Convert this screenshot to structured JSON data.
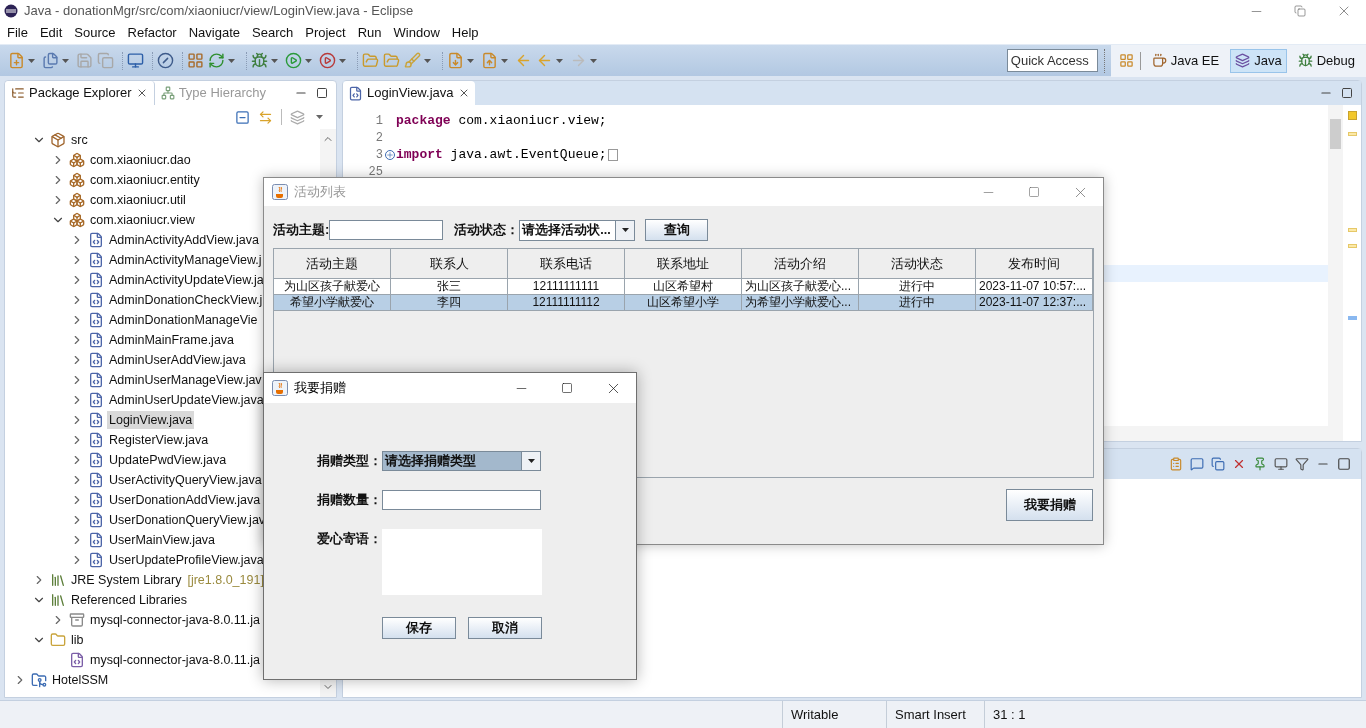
{
  "window": {
    "title": "Java - donationMgr/src/com/xiaoniucr/view/LoginView.java - Eclipse"
  },
  "menu": [
    "File",
    "Edit",
    "Source",
    "Refactor",
    "Navigate",
    "Search",
    "Project",
    "Run",
    "Window",
    "Help"
  ],
  "quick_access": {
    "placeholder": "Quick Access"
  },
  "perspectives": [
    {
      "label": "Java EE",
      "selected": false
    },
    {
      "label": "Java",
      "selected": true
    },
    {
      "label": "Debug",
      "selected": false
    }
  ],
  "left_view": {
    "tabs": [
      {
        "label": "Package Explorer",
        "selected": true
      },
      {
        "label": "Type Hierarchy",
        "selected": false
      }
    ],
    "tree": [
      {
        "children": [
          {
            "label": "src",
            "kind": "source-folder",
            "expanded": true,
            "selected": false,
            "children": [
              {
                "label": "com.xiaoniucr.dao",
                "kind": "package",
                "expanded": false,
                "selected": false
              },
              {
                "label": "com.xiaoniucr.entity",
                "kind": "package",
                "expanded": false,
                "selected": false
              },
              {
                "label": "com.xiaoniucr.util",
                "kind": "package",
                "expanded": false,
                "selected": false
              },
              {
                "label": "com.xiaoniucr.view",
                "kind": "package",
                "expanded": true,
                "selected": false,
                "children": [
                  {
                    "label": "AdminActivityAddView.java",
                    "kind": "java",
                    "expanded": false,
                    "selected": false
                  },
                  {
                    "label": "AdminActivityManageView.j",
                    "kind": "java",
                    "expanded": false,
                    "selected": false
                  },
                  {
                    "label": "AdminActivityUpdateView.ja",
                    "kind": "java",
                    "expanded": false,
                    "selected": false
                  },
                  {
                    "label": "AdminDonationCheckView.j",
                    "kind": "java",
                    "expanded": false,
                    "selected": false
                  },
                  {
                    "label": "AdminDonationManageVie",
                    "kind": "java",
                    "expanded": false,
                    "selected": false
                  },
                  {
                    "label": "AdminMainFrame.java",
                    "kind": "java",
                    "expanded": false,
                    "selected": false
                  },
                  {
                    "label": "AdminUserAddView.java",
                    "kind": "java",
                    "expanded": false,
                    "selected": false
                  },
                  {
                    "label": "AdminUserManageView.jav",
                    "kind": "java",
                    "expanded": false,
                    "selected": false
                  },
                  {
                    "label": "AdminUserUpdateView.java",
                    "kind": "java",
                    "expanded": false,
                    "selected": false
                  },
                  {
                    "label": "LoginView.java",
                    "kind": "java",
                    "expanded": false,
                    "selected": true
                  },
                  {
                    "label": "RegisterView.java",
                    "kind": "java",
                    "expanded": false,
                    "selected": false
                  },
                  {
                    "label": "UpdatePwdView.java",
                    "kind": "java",
                    "expanded": false,
                    "selected": false
                  },
                  {
                    "label": "UserActivityQueryView.java",
                    "kind": "java",
                    "expanded": false,
                    "selected": false
                  },
                  {
                    "label": "UserDonationAddView.java",
                    "kind": "java",
                    "expanded": false,
                    "selected": false
                  },
                  {
                    "label": "UserDonationQueryView.jav",
                    "kind": "java",
                    "expanded": false,
                    "selected": false
                  },
                  {
                    "label": "UserMainView.java",
                    "kind": "java",
                    "expanded": false,
                    "selected": false
                  },
                  {
                    "label": "UserUpdateProfileView.java",
                    "kind": "java",
                    "expanded": false,
                    "selected": false
                  }
                ]
              }
            ]
          },
          {
            "label": "JRE System Library",
            "decoration": "[jre1.8.0_191]",
            "kind": "library",
            "expanded": false,
            "selected": false
          },
          {
            "label": "Referenced Libraries",
            "kind": "library",
            "expanded": true,
            "selected": false,
            "children": [
              {
                "label": "mysql-connector-java-8.0.11.ja",
                "kind": "jar",
                "expanded": false,
                "selected": false
              }
            ]
          },
          {
            "label": "lib",
            "kind": "folder",
            "expanded": true,
            "selected": false,
            "children": [
              {
                "label": "mysql-connector-java-8.0.11.ja",
                "kind": "jar-file",
                "selected": false
              }
            ]
          }
        ]
      },
      {
        "label": "HotelSSM",
        "kind": "project",
        "expanded": false,
        "selected": false
      }
    ]
  },
  "editor": {
    "tabs": [
      {
        "label": "LoginView.java",
        "selected": true
      }
    ],
    "lines": [
      {
        "number": "1",
        "keyword": "package",
        "text": " com.xiaoniucr.view;",
        "folded": false
      },
      {
        "number": "2",
        "folded": false
      },
      {
        "number": "3",
        "keyword": "import",
        "text": " java.awt.EventQueue;",
        "folded": true
      },
      {
        "number": "25",
        "folded": false
      }
    ]
  },
  "status_bar": [
    "Writable",
    "Smart Insert",
    "31 : 1"
  ],
  "activity_window": {
    "title": "活动列表",
    "active": false,
    "search": {
      "topic_label": "活动主题:",
      "status_label": "活动状态：",
      "status_value": "请选择活动状...",
      "query_button": "查询"
    },
    "table": {
      "columns": [
        "活动主题",
        "联系人",
        "联系电话",
        "联系地址",
        "活动介绍",
        "活动状态",
        "发布时间"
      ],
      "rows": [
        {
          "cells": [
            "为山区孩子献爱心",
            "张三",
            "12111111111",
            "山区希望村",
            "为山区孩子献爱心...",
            "进行中",
            "2023-11-07 10:57:..."
          ],
          "selected": false
        },
        {
          "cells": [
            "希望小学献爱心",
            "李四",
            "12111111112",
            "山区希望小学",
            "为希望小学献爱心...",
            "进行中",
            "2023-11-07 12:37:..."
          ],
          "selected": true
        }
      ]
    },
    "donate_button": "我要捐赠"
  },
  "donation_dialog": {
    "title": "我要捐赠",
    "active": true,
    "fields": [
      {
        "kind": "combo",
        "label": "捐赠类型：",
        "value": "请选择捐赠类型",
        "focused": true
      },
      {
        "kind": "text",
        "label": "捐赠数量：",
        "focused": false
      },
      {
        "kind": "textarea",
        "label": "爱心寄语：",
        "focused": false
      }
    ],
    "buttons": [
      "保存",
      "取消"
    ]
  }
}
